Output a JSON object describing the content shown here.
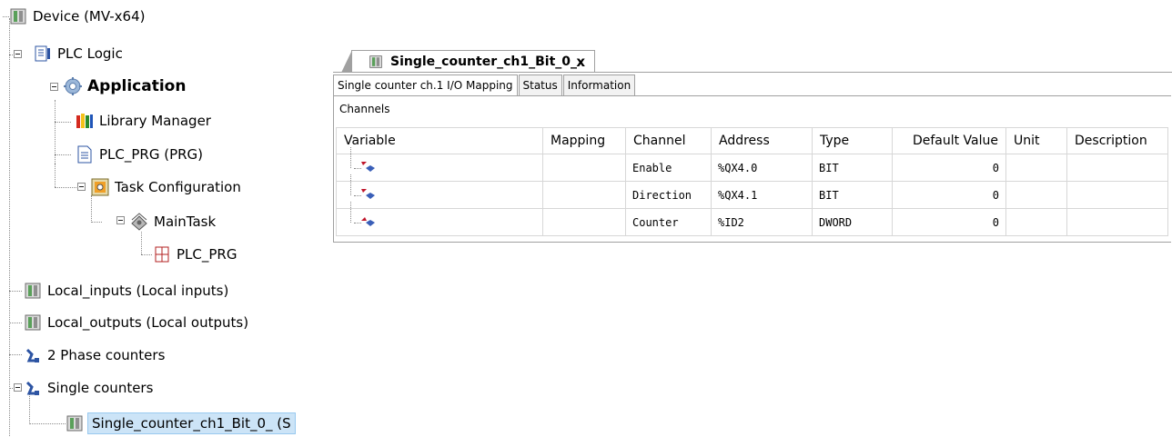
{
  "tree": {
    "device": "Device (MV-x64)",
    "plc_logic": "PLC Logic",
    "application": "Application",
    "library_manager": "Library Manager",
    "plc_prg": "PLC_PRG (PRG)",
    "task_configuration": "Task Configuration",
    "main_task": "MainTask",
    "main_task_prg": "PLC_PRG",
    "local_inputs": "Local_inputs (Local inputs)",
    "local_outputs": "Local_outputs (Local outputs)",
    "two_phase_counters": "2 Phase counters",
    "single_counters": "Single counters",
    "single_counter_item": "Single_counter_ch1_Bit_0_ (S"
  },
  "editor": {
    "document_tab": "Single_counter_ch1_Bit_0_",
    "close_glyph": "x",
    "subtabs": [
      "Single counter ch.1 I/O Mapping",
      "Status",
      "Information"
    ],
    "section_title": "Channels",
    "columns": [
      "Variable",
      "Mapping",
      "Channel",
      "Address",
      "Type",
      "Default Value",
      "Unit",
      "Description"
    ],
    "rows": [
      {
        "variable": "",
        "mapping": "",
        "channel": "Enable",
        "address": "%QX4.0",
        "type": "BIT",
        "default": "0",
        "unit": "",
        "description": "",
        "direction": "output"
      },
      {
        "variable": "",
        "mapping": "",
        "channel": "Direction",
        "address": "%QX4.1",
        "type": "BIT",
        "default": "0",
        "unit": "",
        "description": "",
        "direction": "output"
      },
      {
        "variable": "",
        "mapping": "",
        "channel": "Counter",
        "address": "%ID2",
        "type": "DWORD",
        "default": "0",
        "unit": "",
        "description": "",
        "direction": "input"
      }
    ]
  },
  "colors": {
    "selection": "#cce4f7",
    "gridline": "#d7d7d7",
    "arrow_red": "#c0162b",
    "arrow_blue": "#3a5fb8"
  }
}
